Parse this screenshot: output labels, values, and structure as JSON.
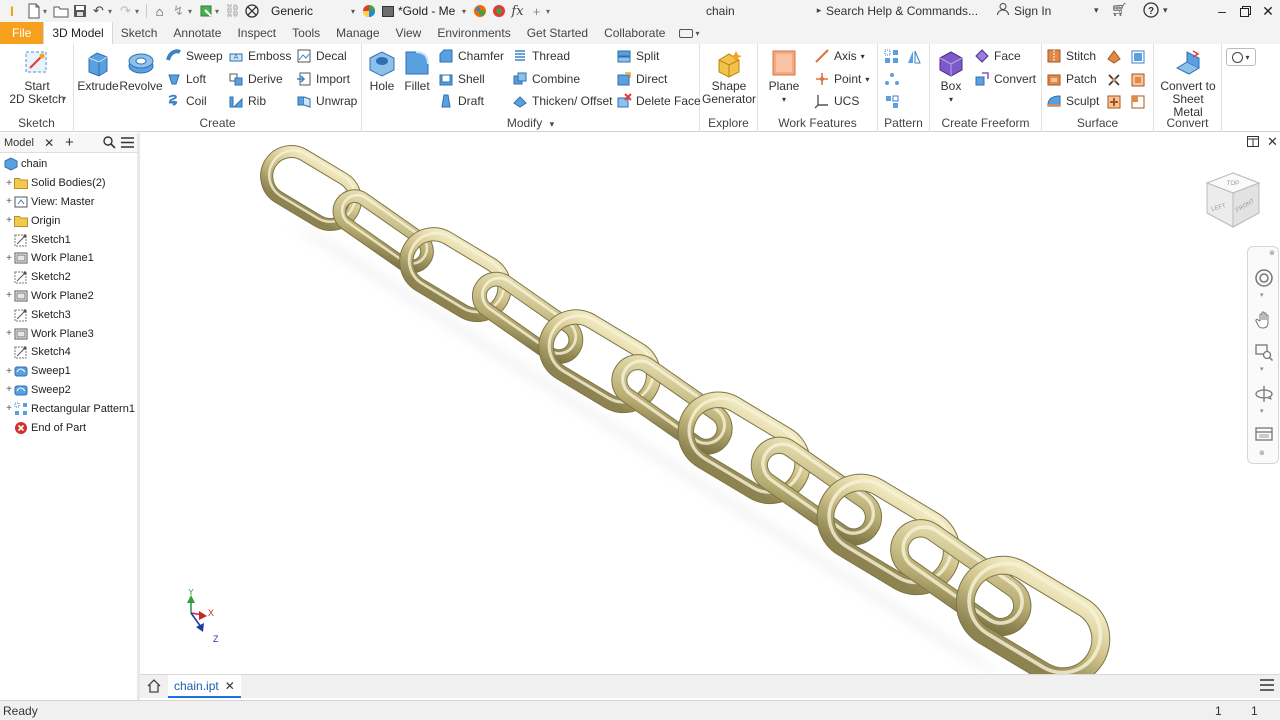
{
  "titlebar": {
    "app_icon": "I",
    "style_dropdown": "Generic",
    "material_dropdown": "*Gold - Me",
    "doc_title": "chain",
    "search_placeholder": "Search Help & Commands...",
    "sign_in": "Sign In"
  },
  "tabs": [
    "File",
    "3D Model",
    "Sketch",
    "Annotate",
    "Inspect",
    "Tools",
    "Manage",
    "View",
    "Environments",
    "Get Started",
    "Collaborate"
  ],
  "ribbon": {
    "sketch": {
      "title": "Sketch",
      "start_line1": "Start",
      "start_line2": "2D Sketch"
    },
    "create": {
      "title": "Create",
      "extrude": "Extrude",
      "revolve": "Revolve",
      "sweep": "Sweep",
      "loft": "Loft",
      "coil": "Coil",
      "emboss": "Emboss",
      "derive": "Derive",
      "rib": "Rib",
      "decal": "Decal",
      "import": "Import",
      "unwrap": "Unwrap"
    },
    "modify": {
      "title": "Modify",
      "hole": "Hole",
      "fillet": "Fillet",
      "chamfer": "Chamfer",
      "shell": "Shell",
      "draft": "Draft",
      "thread": "Thread",
      "combine": "Combine",
      "thicken": "Thicken/ Offset",
      "split": "Split",
      "direct": "Direct",
      "delete_face": "Delete Face"
    },
    "explore": {
      "title": "Explore",
      "shape_line1": "Shape",
      "shape_line2": "Generator"
    },
    "work_features": {
      "title": "Work Features",
      "plane": "Plane",
      "axis": "Axis",
      "point": "Point",
      "ucs": "UCS"
    },
    "pattern": {
      "title": "Pattern"
    },
    "create_freeform": {
      "title": "Create Freeform",
      "box": "Box",
      "face": "Face",
      "convert": "Convert"
    },
    "surface": {
      "title": "Surface",
      "stitch": "Stitch",
      "patch": "Patch",
      "sculpt": "Sculpt"
    },
    "convert": {
      "title": "Convert",
      "line1": "Convert to",
      "line2": "Sheet Metal"
    }
  },
  "browser": {
    "title": "Model",
    "root": "chain",
    "nodes": [
      {
        "label": "Solid Bodies(2)",
        "icon": "folder-icon"
      },
      {
        "label": "View: Master",
        "icon": "view-icon"
      },
      {
        "label": "Origin",
        "icon": "folder-icon"
      },
      {
        "label": "Sketch1",
        "icon": "sketch-icon"
      },
      {
        "label": "Work Plane1",
        "icon": "workplane-icon"
      },
      {
        "label": "Sketch2",
        "icon": "sketch-icon"
      },
      {
        "label": "Work Plane2",
        "icon": "workplane-icon"
      },
      {
        "label": "Sketch3",
        "icon": "sketch-icon"
      },
      {
        "label": "Work Plane3",
        "icon": "workplane-icon"
      },
      {
        "label": "Sketch4",
        "icon": "sketch-icon"
      },
      {
        "label": "Sweep1",
        "icon": "sweep-icon"
      },
      {
        "label": "Sweep2",
        "icon": "sweep-icon"
      },
      {
        "label": "Rectangular Pattern1",
        "icon": "pattern-icon"
      },
      {
        "label": "End of Part",
        "icon": "end-of-part-icon"
      }
    ]
  },
  "viewcube": {
    "top": "TOP",
    "left": "LEFT",
    "front": "FRONT"
  },
  "triad": {
    "x": "X",
    "y": "Y",
    "z": "Z"
  },
  "doctab": {
    "name": "chain.ipt"
  },
  "status": {
    "text": "Ready",
    "count1": "1",
    "count2": "1"
  },
  "colors": {
    "file_tab": "#f7a01d",
    "gold_light": "#e4dcae",
    "gold_mid": "#bdb27a",
    "gold_dark": "#8d8350"
  }
}
